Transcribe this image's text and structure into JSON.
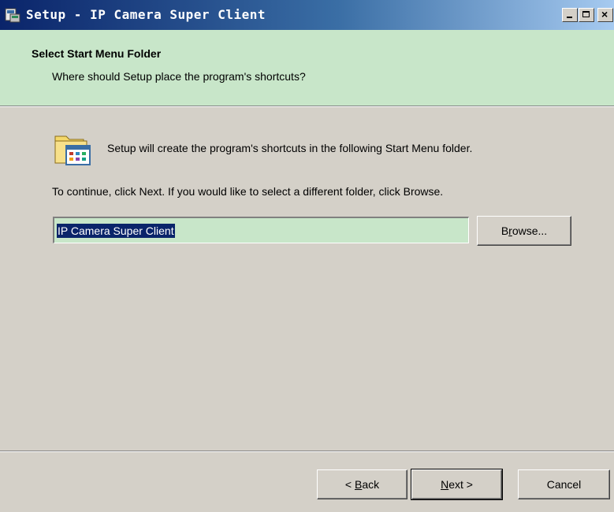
{
  "window": {
    "title": "Setup - IP Camera Super Client"
  },
  "header": {
    "title": "Select Start Menu Folder",
    "subtitle": "Where should Setup place the program's shortcuts?"
  },
  "content": {
    "intro": "Setup will create the program's shortcuts in the following Start Menu folder.",
    "continue_hint": "To continue, click Next. If you would like to select a different folder, click Browse.",
    "folder_value": "IP Camera Super Client"
  },
  "buttons": {
    "browse": {
      "pre": "B",
      "key": "r",
      "post": "owse..."
    },
    "back": {
      "pre": "< ",
      "key": "B",
      "post": "ack"
    },
    "next": {
      "pre": "",
      "key": "N",
      "post": "ext >"
    },
    "cancel": "Cancel"
  },
  "icons": {
    "window_icon": "setup-icon",
    "header_icon": "program-folder-icon"
  },
  "colors": {
    "titlebar_start": "#0a246a",
    "header_bg": "#c8e6c9",
    "selection": "#0a246a"
  }
}
